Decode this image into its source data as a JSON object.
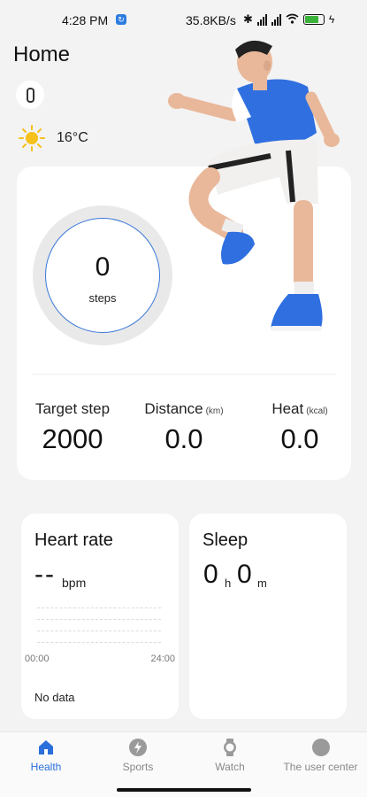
{
  "status_bar": {
    "time": "4:28 PM",
    "network_speed": "35.8KB/s",
    "signal_label": "5Gall"
  },
  "header": {
    "title": "Home",
    "weather_temp": "16°C"
  },
  "steps": {
    "value": "0",
    "unit": "steps",
    "target_label": "Target step",
    "target_value": "2000",
    "distance_label": "Distance",
    "distance_unit": "(km)",
    "distance_value": "0.0",
    "heat_label": "Heat",
    "heat_unit": "(kcal)",
    "heat_value": "0.0"
  },
  "heart_rate": {
    "title": "Heart rate",
    "value": "--",
    "unit": "bpm",
    "axis_start": "00:00",
    "axis_end": "24:00",
    "empty_text": "No data"
  },
  "sleep": {
    "title": "Sleep",
    "hours": "0",
    "hours_unit": "h",
    "minutes": "0",
    "minutes_unit": "m"
  },
  "tabs": [
    {
      "label": "Health",
      "icon": "home-icon",
      "active": true
    },
    {
      "label": "Sports",
      "icon": "sports-icon",
      "active": false
    },
    {
      "label": "Watch",
      "icon": "watch-icon",
      "active": false
    },
    {
      "label": "The user center",
      "icon": "user-center-icon",
      "active": false
    }
  ],
  "colors": {
    "accent": "#2a6fdb",
    "ring": "#3a78d8",
    "battery": "#3bb33b"
  }
}
